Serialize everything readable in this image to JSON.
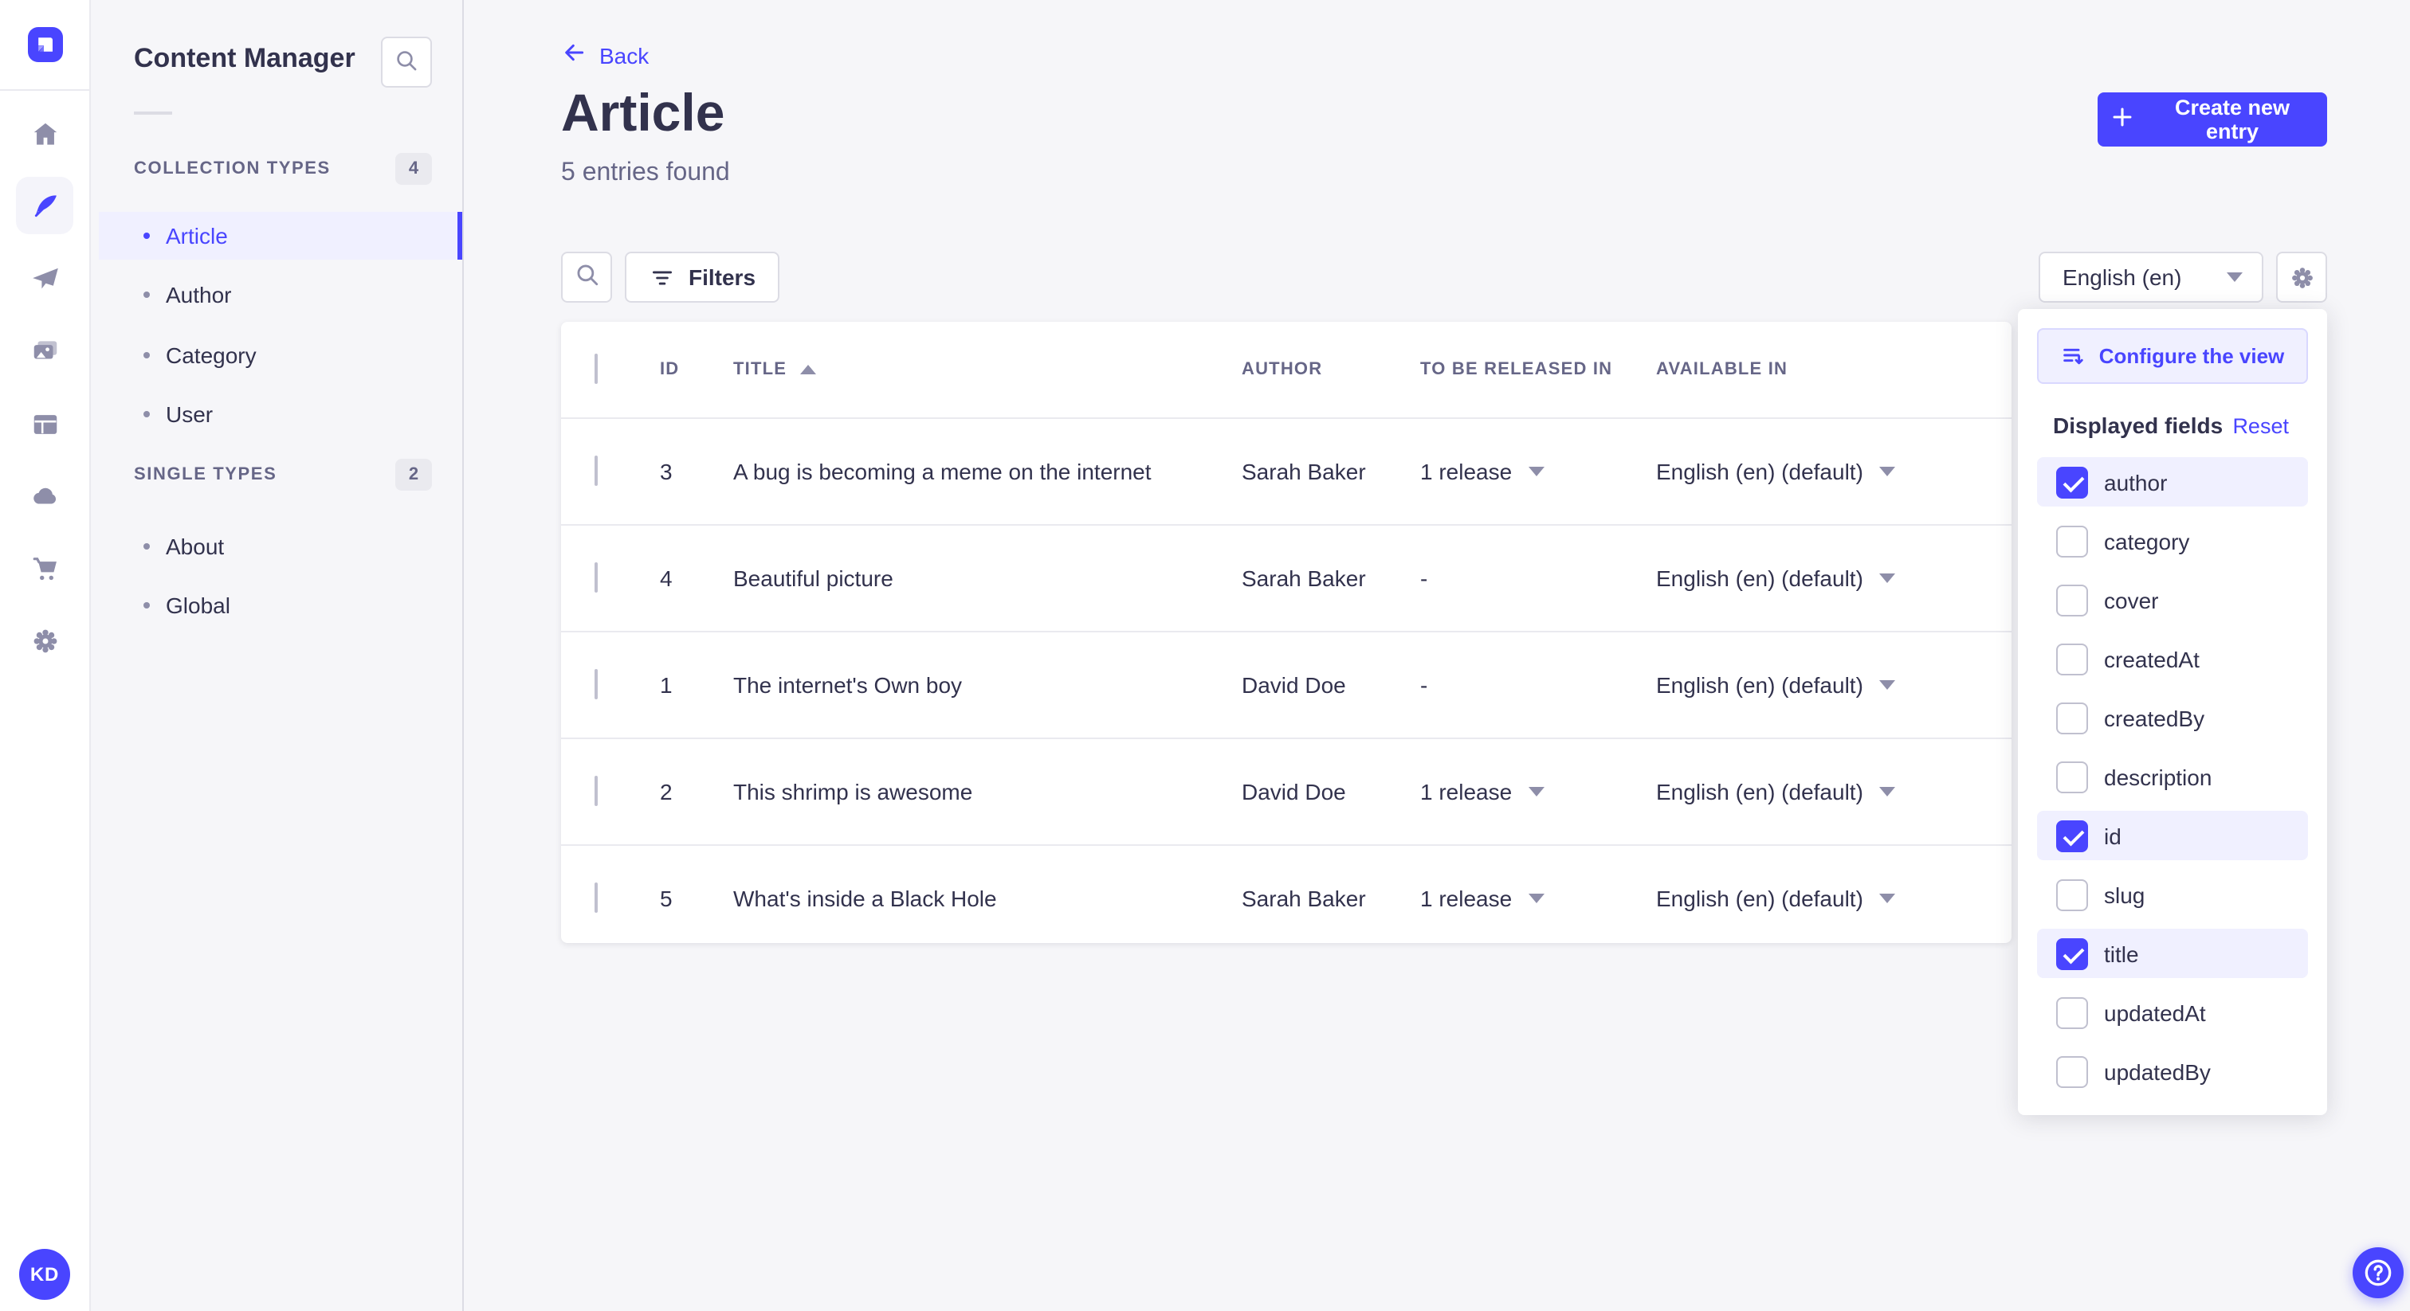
{
  "rail": {
    "logo_icon": "strapi-logo-icon",
    "items": [
      {
        "icon": "home-icon",
        "active": false
      },
      {
        "icon": "content-manager-feather-icon",
        "active": true
      },
      {
        "icon": "paper-plane-icon",
        "active": false
      },
      {
        "icon": "media-library-icon",
        "active": false
      },
      {
        "icon": "layout-builder-icon",
        "active": false
      },
      {
        "icon": "cloud-icon",
        "active": false
      },
      {
        "icon": "marketplace-cart-icon",
        "active": false
      },
      {
        "icon": "settings-gear-icon",
        "active": false
      }
    ],
    "avatar_initials": "KD"
  },
  "subnav": {
    "title": "Content Manager",
    "search_icon": "search-icon",
    "sections": [
      {
        "label": "COLLECTION TYPES",
        "count": "4",
        "items": [
          {
            "label": "Article",
            "active": true
          },
          {
            "label": "Author",
            "active": false
          },
          {
            "label": "Category",
            "active": false
          },
          {
            "label": "User",
            "active": false
          }
        ]
      },
      {
        "label": "SINGLE TYPES",
        "count": "2",
        "items": [
          {
            "label": "About",
            "active": false
          },
          {
            "label": "Global",
            "active": false
          }
        ]
      }
    ]
  },
  "header": {
    "back_label": "Back",
    "title": "Article",
    "subtitle": "5 entries found",
    "create_button_label": "Create new entry"
  },
  "toolbar": {
    "filters_label": "Filters",
    "locale_value": "English (en)"
  },
  "table": {
    "columns": [
      "ID",
      "TITLE",
      "AUTHOR",
      "TO BE RELEASED IN",
      "AVAILABLE IN"
    ],
    "sorted_column": "TITLE",
    "sort_direction": "ascending",
    "rows": [
      {
        "id": "3",
        "title": "A bug is becoming a meme on the internet",
        "author": "Sarah Baker",
        "to_be_released_in": "1 release",
        "release_menu": true,
        "available_in": "English (en) (default)"
      },
      {
        "id": "4",
        "title": "Beautiful picture",
        "author": "Sarah Baker",
        "to_be_released_in": "-",
        "release_menu": false,
        "available_in": "English (en) (default)"
      },
      {
        "id": "1",
        "title": "The internet's Own boy",
        "author": "David Doe",
        "to_be_released_in": "-",
        "release_menu": false,
        "available_in": "English (en) (default)"
      },
      {
        "id": "2",
        "title": "This shrimp is awesome",
        "author": "David Doe",
        "to_be_released_in": "1 release",
        "release_menu": true,
        "available_in": "English (en) (default)"
      },
      {
        "id": "5",
        "title": "What's inside a Black Hole",
        "author": "Sarah Baker",
        "to_be_released_in": "1 release",
        "release_menu": true,
        "available_in": "English (en) (default)"
      }
    ]
  },
  "view_config": {
    "configure_button_label": "Configure the view",
    "section_title": "Displayed fields",
    "reset_label": "Reset",
    "fields": [
      {
        "label": "author",
        "checked": true
      },
      {
        "label": "category",
        "checked": false
      },
      {
        "label": "cover",
        "checked": false
      },
      {
        "label": "createdAt",
        "checked": false
      },
      {
        "label": "createdBy",
        "checked": false
      },
      {
        "label": "description",
        "checked": false
      },
      {
        "label": "id",
        "checked": true
      },
      {
        "label": "slug",
        "checked": false
      },
      {
        "label": "title",
        "checked": true
      },
      {
        "label": "updatedAt",
        "checked": false
      },
      {
        "label": "updatedBy",
        "checked": false
      }
    ]
  },
  "help": {
    "icon": "question-mark-icon"
  },
  "colors": {
    "primary": "#4945FF",
    "primary_light": "#F0F0FF",
    "text_dark": "#32324D",
    "text_muted": "#666687",
    "border": "#DCDCE4",
    "background": "#F6F6F9"
  }
}
